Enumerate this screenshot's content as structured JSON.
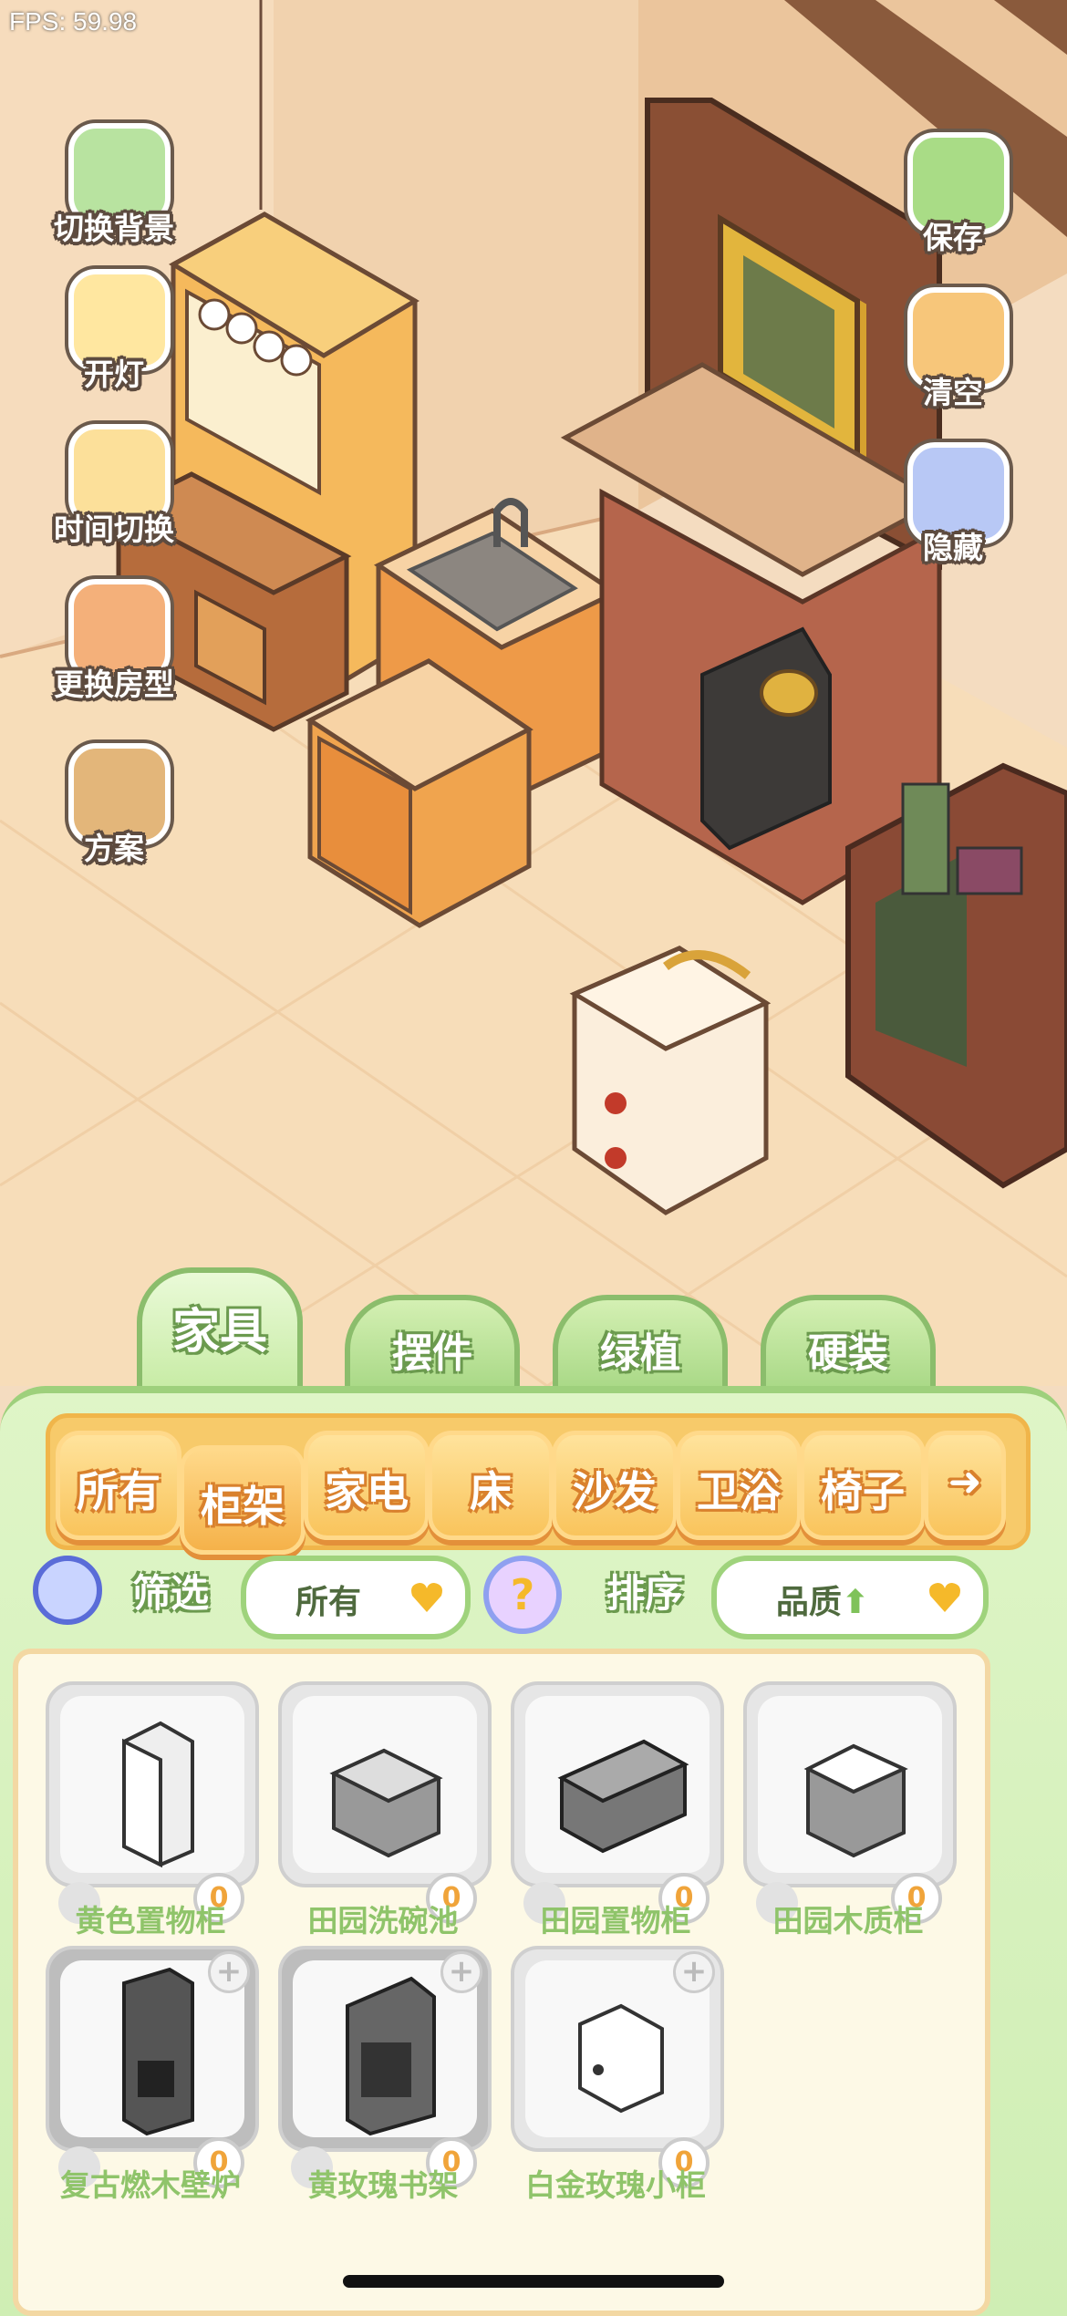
{
  "fps": "FPS: 59.98",
  "left_buttons": [
    {
      "label": "切换背景",
      "icon": "map-scroll-icon"
    },
    {
      "label": "开灯",
      "icon": "lamp-icon"
    },
    {
      "label": "时间切换",
      "icon": "sun-moon-icon"
    },
    {
      "label": "更换房型",
      "icon": "house-icon"
    },
    {
      "label": "方案",
      "icon": "plan-boards-icon"
    }
  ],
  "right_buttons": [
    {
      "label": "保存",
      "icon": "save-mascot-icon"
    },
    {
      "label": "清空",
      "icon": "clear-mascot-icon"
    },
    {
      "label": "隐藏",
      "icon": "hide-eye-icon"
    }
  ],
  "category_tabs": [
    "家具",
    "摆件",
    "绿植",
    "硬装"
  ],
  "active_category": "家具",
  "subcategory_tabs": [
    "所有",
    "柜架",
    "家电",
    "床",
    "沙发",
    "卫浴",
    "椅子"
  ],
  "active_subcategory": "柜架",
  "filter": {
    "label": "筛选",
    "value": "所有"
  },
  "sort": {
    "label": "排序",
    "value": "品质"
  },
  "items": [
    {
      "name": "黄色置物柜",
      "count": "0"
    },
    {
      "name": "田园洗碗池",
      "count": "0"
    },
    {
      "name": "田园置物柜",
      "count": "0"
    },
    {
      "name": "田园木质柜",
      "count": "0"
    },
    {
      "name": "复古燃木壁炉",
      "count": "0"
    },
    {
      "name": "黄玫瑰书架",
      "count": "0"
    },
    {
      "name": "白金玫瑰小柜",
      "count": "0"
    }
  ],
  "colors": {
    "panel_green": "#cfeeb4",
    "tab_orange": "#f9c45c",
    "label_green": "#8fc46a",
    "floor": "#f4dcc0"
  }
}
